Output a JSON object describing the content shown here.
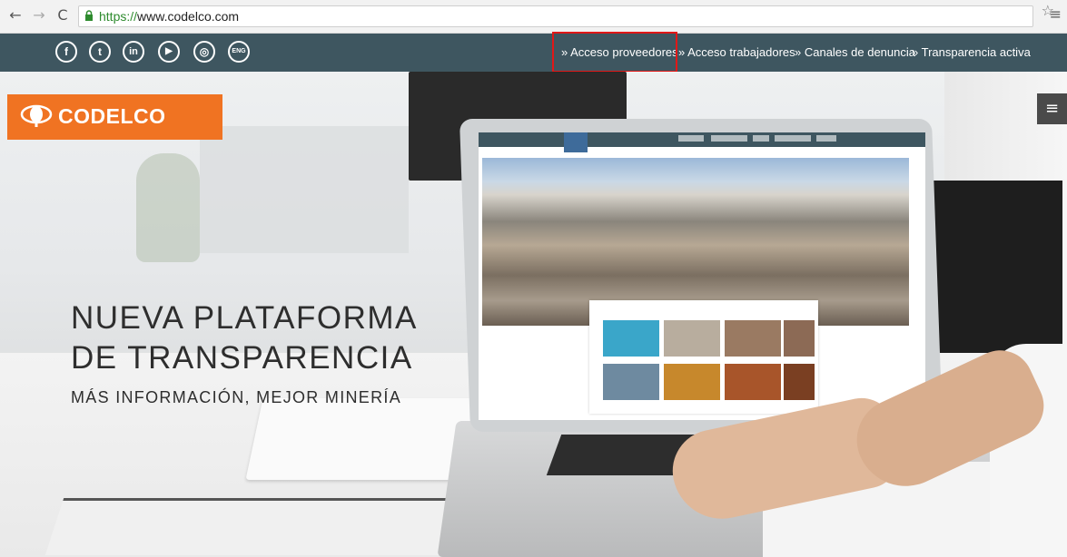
{
  "browser": {
    "back_icon": "arrow-left-icon",
    "forward_icon": "arrow-right-icon",
    "reload_icon": "reload-icon",
    "url_scheme": "https://",
    "url_host": "www.codelco.com"
  },
  "topbar": {
    "social": [
      {
        "name": "facebook",
        "glyph": "f"
      },
      {
        "name": "twitter",
        "glyph": "t"
      },
      {
        "name": "linkedin",
        "glyph": "in"
      },
      {
        "name": "youtube",
        "glyph": "▶"
      },
      {
        "name": "instagram",
        "glyph": "◎"
      },
      {
        "name": "english",
        "glyph": "ENG"
      }
    ],
    "links": [
      "» Acceso proveedores",
      "» Acceso trabajadores",
      "» Canales de denuncia",
      "» Transparencia activa"
    ],
    "background": "#3e5660"
  },
  "hero": {
    "logo_text": "CODELCO",
    "logo_color": "#f07322",
    "headline_line1": "NUEVA PLATAFORMA",
    "headline_line2": "DE TRANSPARENCIA",
    "subline": "MÁS INFORMACIÓN, MEJOR MINERÍA",
    "menu_glyph": "≡"
  }
}
